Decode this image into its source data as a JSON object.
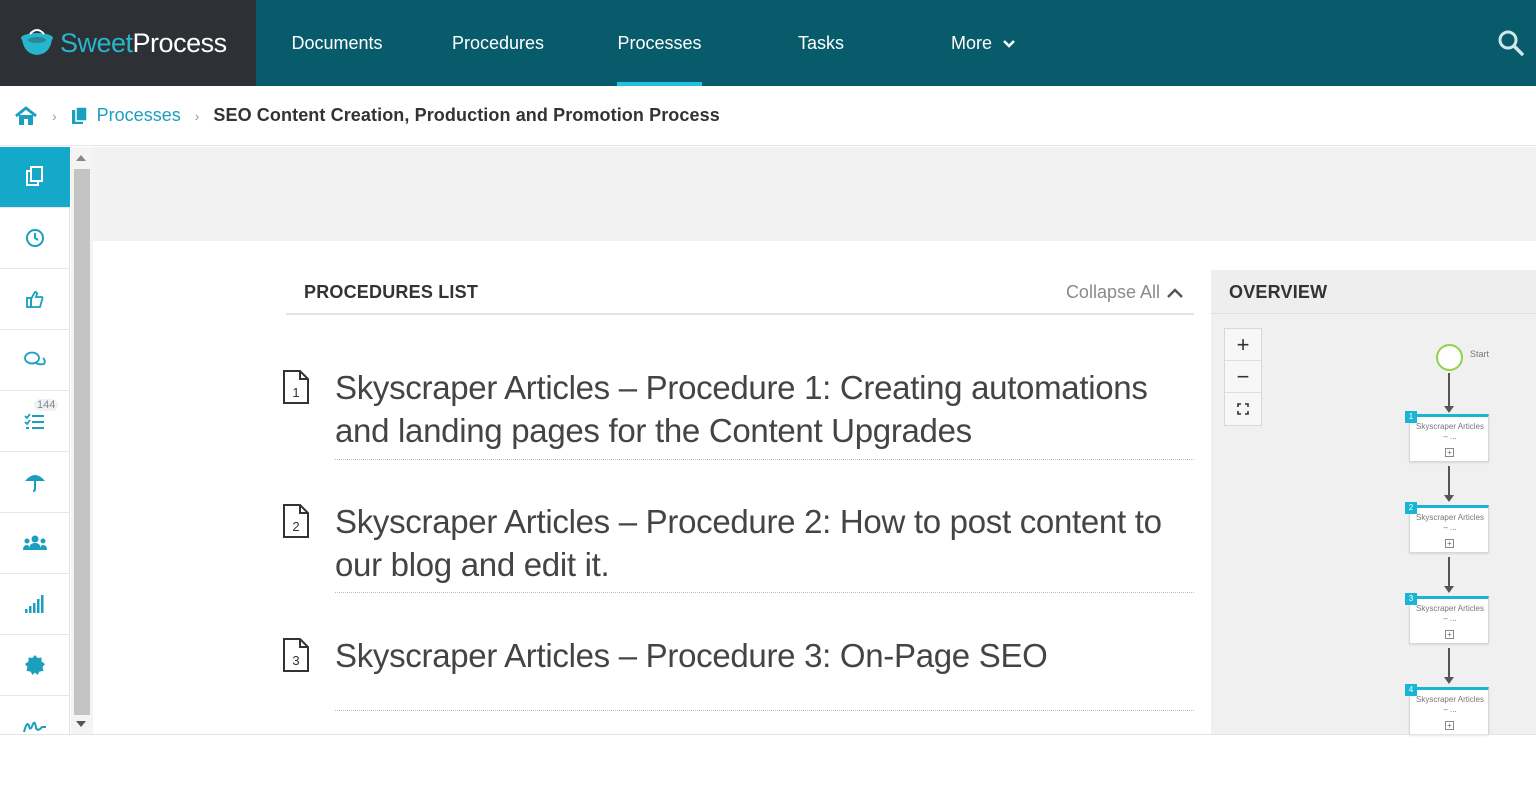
{
  "brand": {
    "part1": "Sweet",
    "part2": "Process"
  },
  "nav": {
    "items": [
      {
        "label": "Documents"
      },
      {
        "label": "Procedures"
      },
      {
        "label": "Processes"
      },
      {
        "label": "Tasks"
      },
      {
        "label": "More"
      }
    ],
    "active": "Processes"
  },
  "breadcrumb": {
    "section": "Processes",
    "current": "SEO Content Creation, Production and Promotion Process"
  },
  "rail": {
    "items": [
      "documents-icon",
      "clock-icon",
      "thumbs-up-icon",
      "comments-icon",
      "tasks-list-icon",
      "umbrella-icon",
      "team-icon",
      "signal-bars-icon",
      "badge-icon",
      "signature-icon"
    ],
    "tasks_badge": "144"
  },
  "procedures": {
    "title": "PROCEDURES LIST",
    "collapse_label": "Collapse All",
    "items": [
      {
        "num": "1",
        "text": "Skyscraper Articles – Procedure 1: Creating automations and landing pages for the Content Upgrades"
      },
      {
        "num": "2",
        "text": "Skyscraper Articles – Procedure 2: How to post content to our blog and edit it."
      },
      {
        "num": "3",
        "text": "Skyscraper Articles – Procedure 3: On-Page SEO"
      }
    ]
  },
  "overview": {
    "title": "OVERVIEW",
    "zoom_in": "+",
    "zoom_out": "−",
    "start_label": "Start",
    "nodes": [
      {
        "num": "1",
        "text": "Skyscraper Articles – ..."
      },
      {
        "num": "2",
        "text": "Skyscraper Articles – ..."
      },
      {
        "num": "3",
        "text": "Skyscraper Articles – ..."
      },
      {
        "num": "4",
        "text": "Skyscraper Articles – ..."
      }
    ]
  },
  "colors": {
    "nav_bg": "#085b6b",
    "accent": "#14a8c9",
    "logo_bg": "#2d3035"
  }
}
